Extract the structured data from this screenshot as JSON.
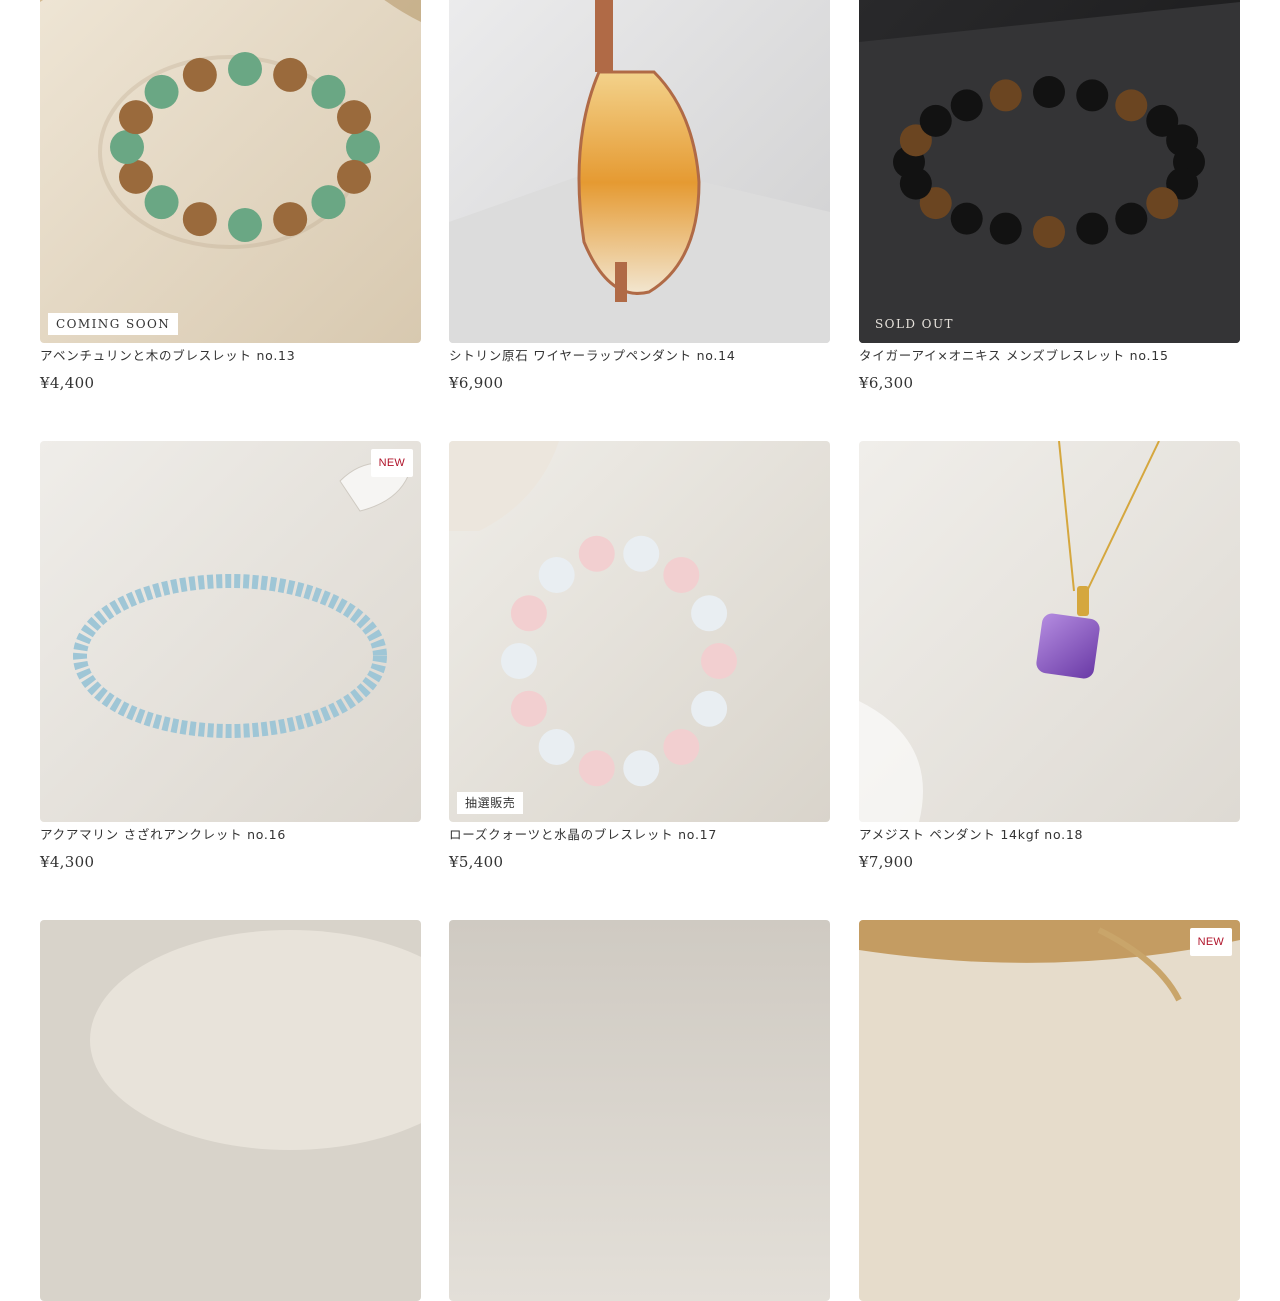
{
  "products": [
    {
      "title": "アベンチュリンと木のブレスレット no.13",
      "price": "¥4,400",
      "badge": "COMING SOON"
    },
    {
      "title": "シトリン原石 ワイヤーラップペンダント no.14",
      "price": "¥6,900",
      "badge": ""
    },
    {
      "title": "タイガーアイ×オニキス メンズブレスレット no.15",
      "price": "¥6,300",
      "badge": "SOLD OUT"
    },
    {
      "title": "アクアマリン さざれアンクレット no.16",
      "price": "¥4,300",
      "badge": "NEW"
    },
    {
      "title": "ローズクォーツと水晶のブレスレット no.17",
      "price": "¥5,400",
      "badge": "抽選販売"
    },
    {
      "title": "アメジスト ペンダント 14kgf no.18",
      "price": "¥7,900",
      "badge": ""
    },
    {
      "title": "",
      "price": "",
      "badge": ""
    },
    {
      "title": "",
      "price": "",
      "badge": ""
    },
    {
      "title": "",
      "price": "",
      "badge": "NEW"
    }
  ],
  "colors": {
    "new_badge": "#b0132a",
    "text": "#333333"
  }
}
